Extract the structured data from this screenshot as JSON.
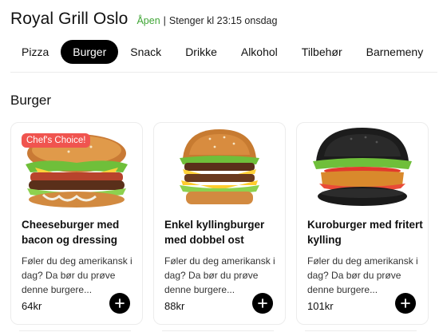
{
  "header": {
    "restaurant_name": "Royal Grill Oslo",
    "status_open": "Åpen",
    "status_separator": "|",
    "status_hours": "Stenger kl 23:15 onsdag",
    "status_color": "#3fa535"
  },
  "tabs": [
    {
      "label": "Pizza",
      "active": false
    },
    {
      "label": "Burger",
      "active": true
    },
    {
      "label": "Snack",
      "active": false
    },
    {
      "label": "Drikke",
      "active": false
    },
    {
      "label": "Alkohol",
      "active": false
    },
    {
      "label": "Tilbehør",
      "active": false
    },
    {
      "label": "Barnemeny",
      "active": false
    }
  ],
  "section": {
    "title": "Burger"
  },
  "products": [
    {
      "badge": "Chef's Choice!",
      "title": "Cheeseburger med bacon og dressing",
      "description": "Føler du deg amerikansk i dag? Da bør du prøve denne burgere...",
      "price": "64kr",
      "image_icon": "cheeseburger-image"
    },
    {
      "badge": "",
      "title": "Enkel kyllingburger med dobbel ost",
      "description": "Føler du deg amerikansk i dag? Da bør du prøve denne burgere...",
      "price": "88kr",
      "image_icon": "chicken-burger-image"
    },
    {
      "badge": "",
      "title": "Kuroburger med fritert kylling",
      "description": "Føler du deg amerikansk i dag? Da bør du prøve denne burgere...",
      "price": "101kr",
      "image_icon": "black-bun-burger-image"
    }
  ],
  "colors": {
    "accent": "#000000",
    "badge": "#f0544f"
  },
  "icons": {
    "add": "plus-icon"
  }
}
